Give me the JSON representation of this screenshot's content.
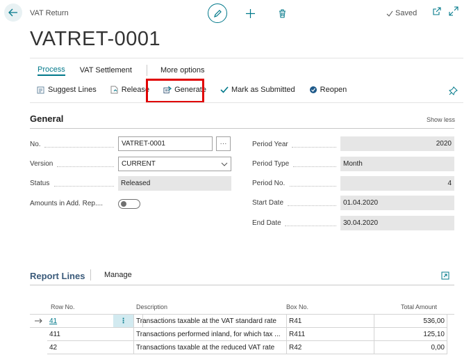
{
  "header": {
    "caption": "VAT Return",
    "status": "Saved",
    "title": "VATRET-0001"
  },
  "tabs": [
    {
      "label": "Process",
      "active": true
    },
    {
      "label": "VAT Settlement",
      "active": false
    },
    {
      "label": "More options",
      "active": false
    }
  ],
  "actions": {
    "suggest_lines": "Suggest Lines",
    "release": "Release",
    "generate": "Generate",
    "mark_as_submitted": "Mark as Submitted",
    "reopen": "Reopen"
  },
  "general": {
    "title": "General",
    "show_less": "Show less",
    "no_label": "No.",
    "no_value": "VATRET-0001",
    "version_label": "Version",
    "version_value": "CURRENT",
    "status_label": "Status",
    "status_value": "Released",
    "amounts_label": "Amounts in Add. Rep....",
    "amounts_toggle": false,
    "period_year_label": "Period Year",
    "period_year_value": "2020",
    "period_type_label": "Period Type",
    "period_type_value": "Month",
    "period_no_label": "Period No.",
    "period_no_value": "4",
    "start_date_label": "Start Date",
    "start_date_value": "01.04.2020",
    "end_date_label": "End Date",
    "end_date_value": "30.04.2020"
  },
  "report_lines": {
    "title": "Report Lines",
    "manage": "Manage",
    "columns": [
      "Row No.",
      "Description",
      "Box No.",
      "Total Amount"
    ],
    "rows": [
      {
        "row_no": "41",
        "description": "Transactions taxable at the VAT standard rate",
        "box_no": "R41",
        "total": "536,00"
      },
      {
        "row_no": "411",
        "description": "Transactions performed inland, for which tax ...",
        "box_no": "R411",
        "total": "125,10"
      },
      {
        "row_no": "42",
        "description": "Transactions taxable at the reduced VAT rate",
        "box_no": "R42",
        "total": "0,00"
      }
    ]
  },
  "colors": {
    "accent": "#00788a",
    "highlight": "#e00000",
    "readonly_field": "#e6e6e6"
  }
}
